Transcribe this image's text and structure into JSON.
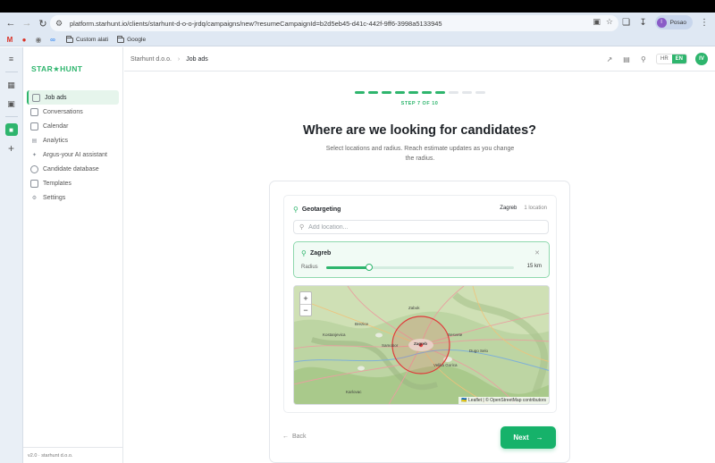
{
  "browser": {
    "url": "platform.starhunt.io/clients/starhunt-d-o-o-jrdq/campaigns/new?resumeCampaignId=b2d5eb45-d41c-442f-9ff6-3998a5133945",
    "profile_initial": "I",
    "profile_label": "Posao",
    "bookmarks": [
      {
        "label": "Custom alati"
      },
      {
        "label": "Google"
      }
    ]
  },
  "app": {
    "logo": "STAR★HUNT",
    "version": "v2.0 · starhunt d.o.o.",
    "nav": [
      {
        "label": "Job ads",
        "icon": "folder-icon",
        "active": true
      },
      {
        "label": "Conversations",
        "icon": "chat-icon"
      },
      {
        "label": "Calendar",
        "icon": "calendar-icon"
      },
      {
        "label": "Analytics",
        "icon": "chart-icon"
      },
      {
        "label": "Argus-your AI assistant",
        "icon": "sparkle-icon"
      },
      {
        "label": "Candidate database",
        "icon": "user-icon"
      },
      {
        "label": "Templates",
        "icon": "document-icon"
      },
      {
        "label": "Settings",
        "icon": "gear-icon"
      }
    ]
  },
  "header": {
    "breadcrumb": [
      "Starhunt d.o.o.",
      "Job ads"
    ],
    "lang_hr": "HR",
    "lang_en": "EN",
    "user_initials": "IV"
  },
  "wizard": {
    "step_label": "STEP 7 OF 10",
    "steps_total": 10,
    "steps_done": 7,
    "title": "Where are we looking for candidates?",
    "subtitle": "Select locations and radius. Reach estimate updates as you change the radius.",
    "geo_title": "Geotargeting",
    "geo_city": "Zagreb",
    "geo_count": "1 location",
    "search_placeholder": "Add location...",
    "location": {
      "name": "Zagreb",
      "radius_label": "Radius",
      "radius_value": "15 km",
      "radius_fraction": 0.23
    },
    "map": {
      "attribution": "🇺🇦 Leaflet | © OpenStreetMap contributors",
      "zoom_in": "+",
      "zoom_out": "−",
      "labels": [
        {
          "text": "Zagreb"
        },
        {
          "text": "Velika Gorica"
        },
        {
          "text": "Samobor"
        },
        {
          "text": "Zabok"
        },
        {
          "text": "Sesvete"
        },
        {
          "text": "Karlovac"
        },
        {
          "text": "Kostanjevica"
        },
        {
          "text": "Brezice"
        },
        {
          "text": "Dugo Selo"
        }
      ]
    },
    "back_label": "Back",
    "next_label": "Next"
  },
  "colors": {
    "accent": "#2eb56d",
    "radius_circle": "#e03a3a"
  }
}
